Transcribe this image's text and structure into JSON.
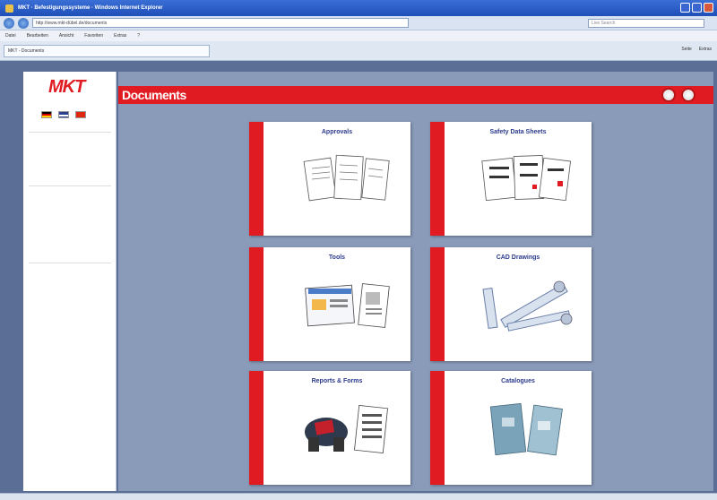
{
  "window": {
    "title_bar_text": "MKT · Befestigungssysteme · Windows Internet Explorer",
    "address": "http://www.mkt-dübel.de/documents",
    "search_placeholder": "Live Search",
    "tab_title": "MKT - Documents"
  },
  "menu": [
    "Datei",
    "Bearbeiten",
    "Ansicht",
    "Favoriten",
    "Extras",
    "?"
  ],
  "tools": [
    "Seite",
    "Extras"
  ],
  "brand": {
    "logo": "MKT"
  },
  "sidebar": {
    "sections": [
      {
        "items": []
      },
      {
        "items": []
      },
      {
        "items": []
      }
    ]
  },
  "page": {
    "title": "Documents"
  },
  "cards": [
    {
      "title": "Approvals"
    },
    {
      "title": "Safety Data Sheets"
    },
    {
      "title": "Tools"
    },
    {
      "title": "CAD Drawings"
    },
    {
      "title": "Reports & Forms"
    },
    {
      "title": "Catalogues"
    }
  ],
  "colors": {
    "brand_red": "#e11b22",
    "link_blue": "#2b3a8c",
    "panel_bg": "#8a9bba"
  }
}
